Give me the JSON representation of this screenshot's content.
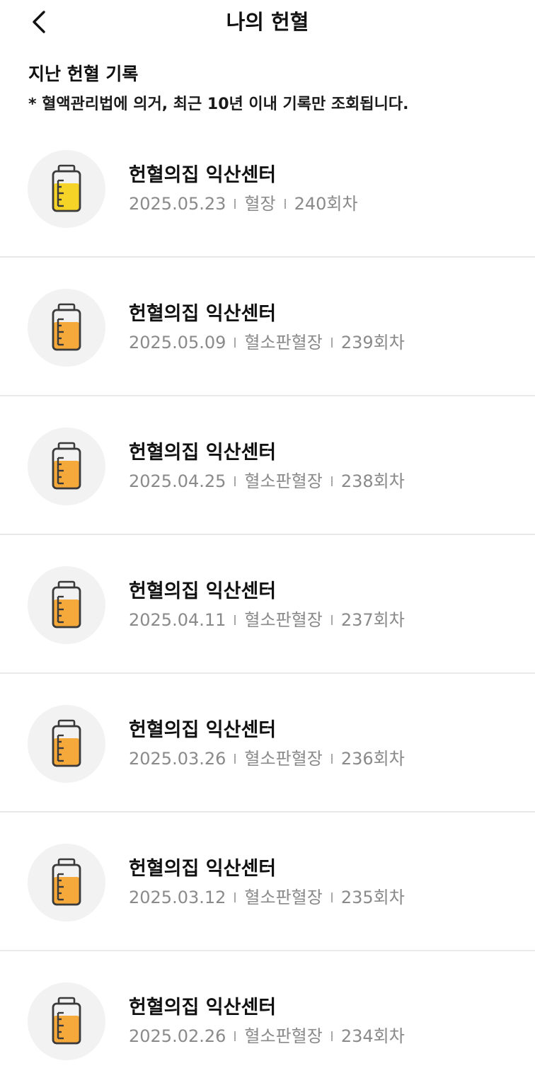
{
  "header": {
    "title": "나의 헌혈",
    "back_icon": "chevron-left-icon"
  },
  "section": {
    "title": "지난 헌혈 기록",
    "notice": "* 혈액관리법에 의거, 최근 10년 이내 기록만 조회됩니다."
  },
  "colors": {
    "whole_blood_fill": "#f5d327",
    "apheresis_fill": "#f5a93a",
    "icon_outline": "#3a3a3a",
    "icon_bg": "#f2f2f2",
    "meta_text": "#8a8a8a"
  },
  "records": [
    {
      "center": "헌혈의집 익산센터",
      "date": "2025.05.23",
      "type": "혈장",
      "count": "240회차",
      "icon": "blood-bag-icon",
      "fill_color": "#f5d327",
      "fill_level": 0.7
    },
    {
      "center": "헌혈의집 익산센터",
      "date": "2025.05.09",
      "type": "혈소판혈장",
      "count": "239회차",
      "icon": "blood-bag-icon",
      "fill_color": "#f5a93a",
      "fill_level": 0.7
    },
    {
      "center": "헌혈의집 익산센터",
      "date": "2025.04.25",
      "type": "혈소판혈장",
      "count": "238회차",
      "icon": "blood-bag-icon",
      "fill_color": "#f5a93a",
      "fill_level": 0.7
    },
    {
      "center": "헌혈의집 익산센터",
      "date": "2025.04.11",
      "type": "혈소판혈장",
      "count": "237회차",
      "icon": "blood-bag-icon",
      "fill_color": "#f5a93a",
      "fill_level": 0.7
    },
    {
      "center": "헌혈의집 익산센터",
      "date": "2025.03.26",
      "type": "혈소판혈장",
      "count": "236회차",
      "icon": "blood-bag-icon",
      "fill_color": "#f5a93a",
      "fill_level": 0.7
    },
    {
      "center": "헌혈의집 익산센터",
      "date": "2025.03.12",
      "type": "혈소판혈장",
      "count": "235회차",
      "icon": "blood-bag-icon",
      "fill_color": "#f5a93a",
      "fill_level": 0.7
    },
    {
      "center": "헌혈의집 익산센터",
      "date": "2025.02.26",
      "type": "혈소판혈장",
      "count": "234회차",
      "icon": "blood-bag-icon",
      "fill_color": "#f5a93a",
      "fill_level": 0.7
    }
  ]
}
